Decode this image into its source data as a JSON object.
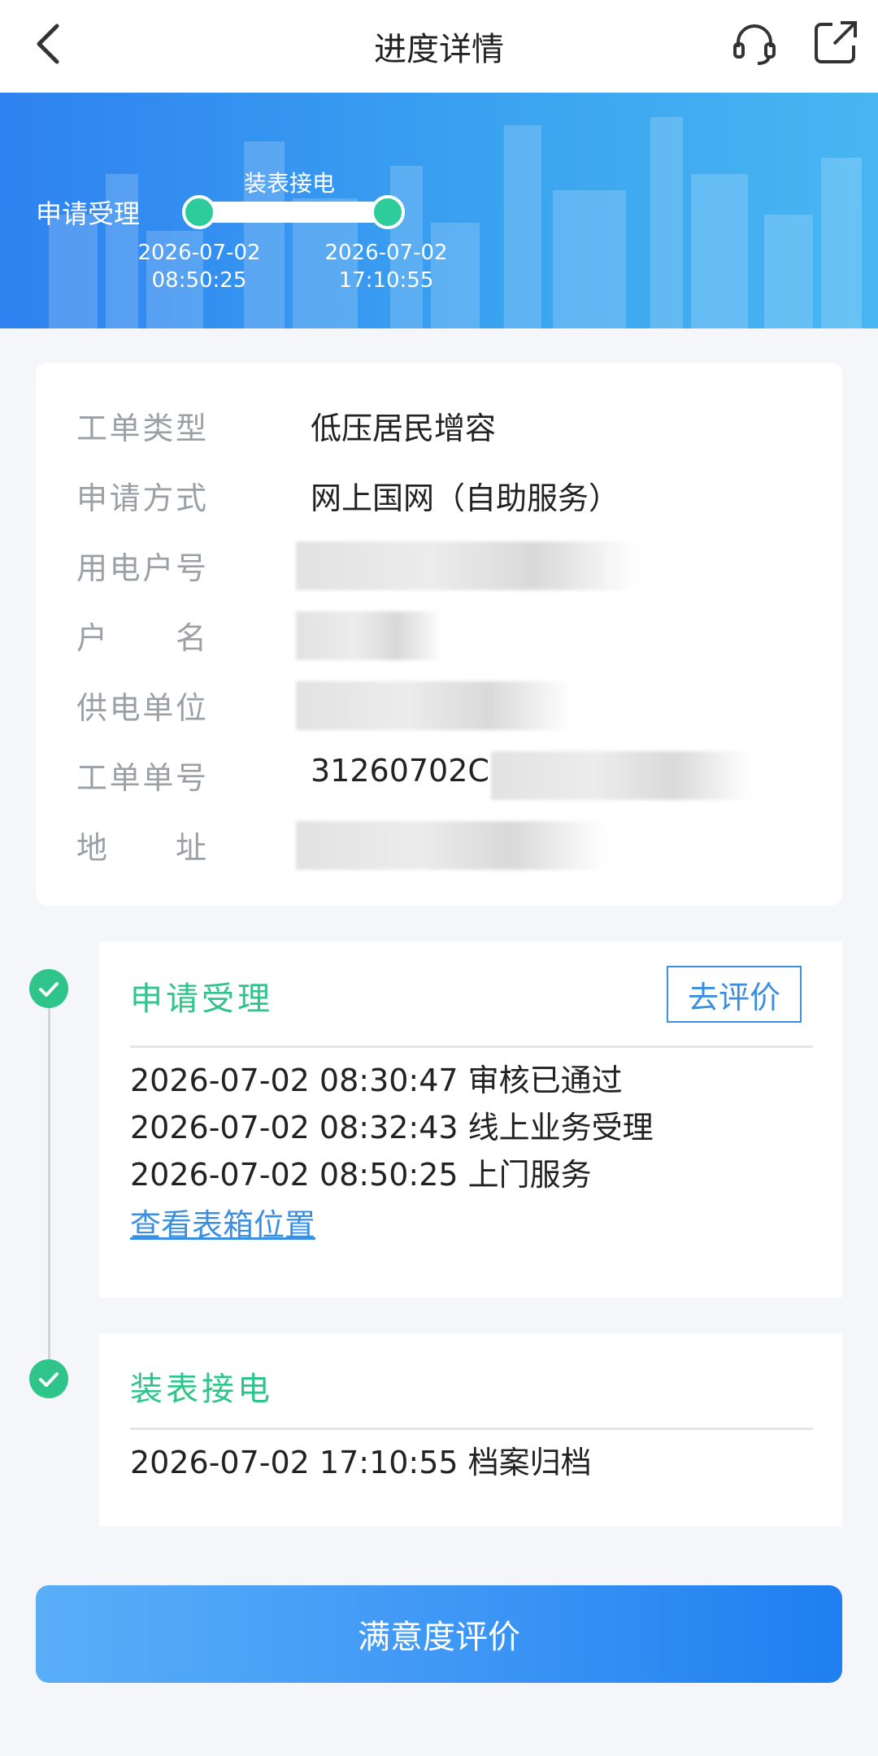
{
  "header": {
    "title": "进度详情"
  },
  "banner": {
    "current_stage": "申请受理",
    "next_stage": "装表接电",
    "times": [
      {
        "date": "2026-07-02",
        "time": "08:50:25"
      },
      {
        "date": "2026-07-02",
        "time": "17:10:55"
      }
    ]
  },
  "info": {
    "rows": [
      {
        "label": "工单类型",
        "value": "低压居民增容"
      },
      {
        "label": "申请方式",
        "value": "网上国网（自助服务）"
      },
      {
        "label": "用电户号",
        "value": "31056"
      },
      {
        "label": "户名",
        "value": ""
      },
      {
        "label": "供电单位",
        "value": ""
      },
      {
        "label": "工单单号",
        "value": "31260702C"
      },
      {
        "label": "地址",
        "value": ""
      }
    ]
  },
  "timeline": {
    "step1": {
      "title": "申请受理",
      "eval_label": "去评价",
      "entries": [
        "2026-07-02 08:30:47 审核已通过",
        "2026-07-02 08:32:43 线上业务受理",
        "2026-07-02 08:50:25 上门服务"
      ],
      "link": "查看表箱位置"
    },
    "step2": {
      "title": "装表接电",
      "entries": [
        "2026-07-02 17:10:55 档案归档"
      ]
    }
  },
  "bottom": {
    "button_label": "满意度评价"
  },
  "colors": {
    "accent_green": "#2ec48a",
    "accent_blue": "#3b8fe0",
    "banner_start": "#2f82f0",
    "banner_end": "#48b6f2"
  }
}
